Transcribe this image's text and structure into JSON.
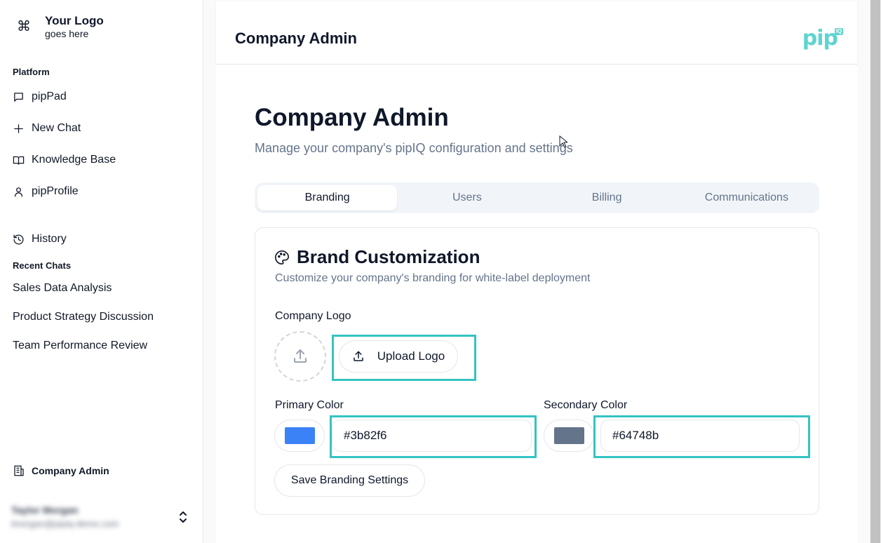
{
  "sidebar": {
    "logo": {
      "icon": "command-icon",
      "title": "Your Logo",
      "subtitle": "goes here"
    },
    "platform_label": "Platform",
    "nav": [
      {
        "label": "pipPad",
        "icon": "chat-bubble-icon"
      },
      {
        "label": "New Chat",
        "icon": "plus-icon"
      },
      {
        "label": "Knowledge Base",
        "icon": "book-icon"
      },
      {
        "label": "pipProfile",
        "icon": "user-icon"
      }
    ],
    "history_label": "History",
    "recent_label": "Recent Chats",
    "recent_chats": [
      "Sales Data Analysis",
      "Product Strategy Discussion",
      "Team Performance Review"
    ],
    "company_admin_label": "Company Admin",
    "user": {
      "name": "Taylor Morgan",
      "email": "tmorgan@pipiq-demo.com"
    }
  },
  "header": {
    "title": "Company Admin",
    "brand": "pip",
    "brand_badge": "IQ"
  },
  "page": {
    "title": "Company Admin",
    "subtitle": "Manage your company's pipIQ configuration and settings"
  },
  "tabs": [
    {
      "label": "Branding",
      "active": true
    },
    {
      "label": "Users",
      "active": false
    },
    {
      "label": "Billing",
      "active": false
    },
    {
      "label": "Communications",
      "active": false
    }
  ],
  "card": {
    "icon": "palette-icon",
    "title": "Brand Customization",
    "description": "Customize your company's branding for white-label deployment",
    "logo_label": "Company Logo",
    "upload_label": "Upload Logo",
    "primary_label": "Primary Color",
    "primary_value": "#3b82f6",
    "secondary_label": "Secondary Color",
    "secondary_value": "#64748b",
    "save_label": "Save Branding Settings"
  },
  "colors": {
    "brand_teal": "#5fd4d1",
    "highlight": "#34c3c3",
    "primary_swatch": "#3b82f6",
    "secondary_swatch": "#64748b"
  }
}
